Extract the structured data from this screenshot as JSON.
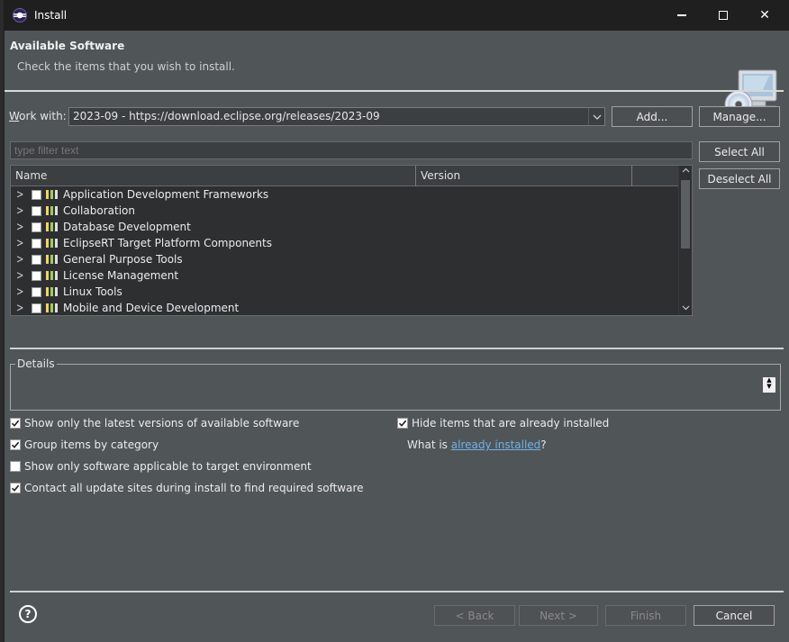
{
  "window": {
    "title": "Install",
    "minimize_glyph": "",
    "close_glyph": "✕"
  },
  "header": {
    "title": "Available Software",
    "description": "Check the items that you wish to install.",
    "icon": "cd-computer-icon"
  },
  "work_with": {
    "label_prefix": "",
    "label_mnemonic": "W",
    "label_rest": "ork with:",
    "value": "2023-09 - https://download.eclipse.org/releases/2023-09",
    "add_button": "Add...",
    "manage_button": "Manage..."
  },
  "filter": {
    "placeholder": "type filter text"
  },
  "selection": {
    "select_all": "Select All",
    "deselect_all": "Deselect All"
  },
  "tree": {
    "columns": [
      "Name",
      "Version"
    ],
    "items": [
      {
        "label": "Application Development Frameworks",
        "checked": false
      },
      {
        "label": "Collaboration",
        "checked": false
      },
      {
        "label": "Database Development",
        "checked": false
      },
      {
        "label": "EclipseRT Target Platform Components",
        "checked": false
      },
      {
        "label": "General Purpose Tools",
        "checked": false
      },
      {
        "label": "License Management",
        "checked": false
      },
      {
        "label": "Linux Tools",
        "checked": false
      },
      {
        "label": "Mobile and Device Development",
        "checked": false
      }
    ],
    "category_icon_colors": [
      "#f4d35e",
      "#9ccc65",
      "#e0e0e0"
    ]
  },
  "details": {
    "legend": "Details"
  },
  "options": {
    "latest_versions": {
      "label": "Show only the latest versions of available software",
      "checked": true
    },
    "group_by_category": {
      "label": "Group items by category",
      "checked": true
    },
    "target_env": {
      "label": "Show only software applicable to target environment",
      "checked": false
    },
    "contact_sites": {
      "label": "Contact all update sites during install to find required software",
      "checked": true
    },
    "hide_installed": {
      "label": "Hide items that are already installed",
      "checked": true
    },
    "what_is_prefix": "What is ",
    "what_is_link": "already installed",
    "what_is_suffix": "?"
  },
  "footer": {
    "back": "< Back",
    "next": "Next >",
    "finish": "Finish",
    "cancel": "Cancel"
  },
  "colors": {
    "dialog_bg": "#505558",
    "titlebar_bg": "#1f1f1f",
    "link": "#6fb2e8"
  }
}
